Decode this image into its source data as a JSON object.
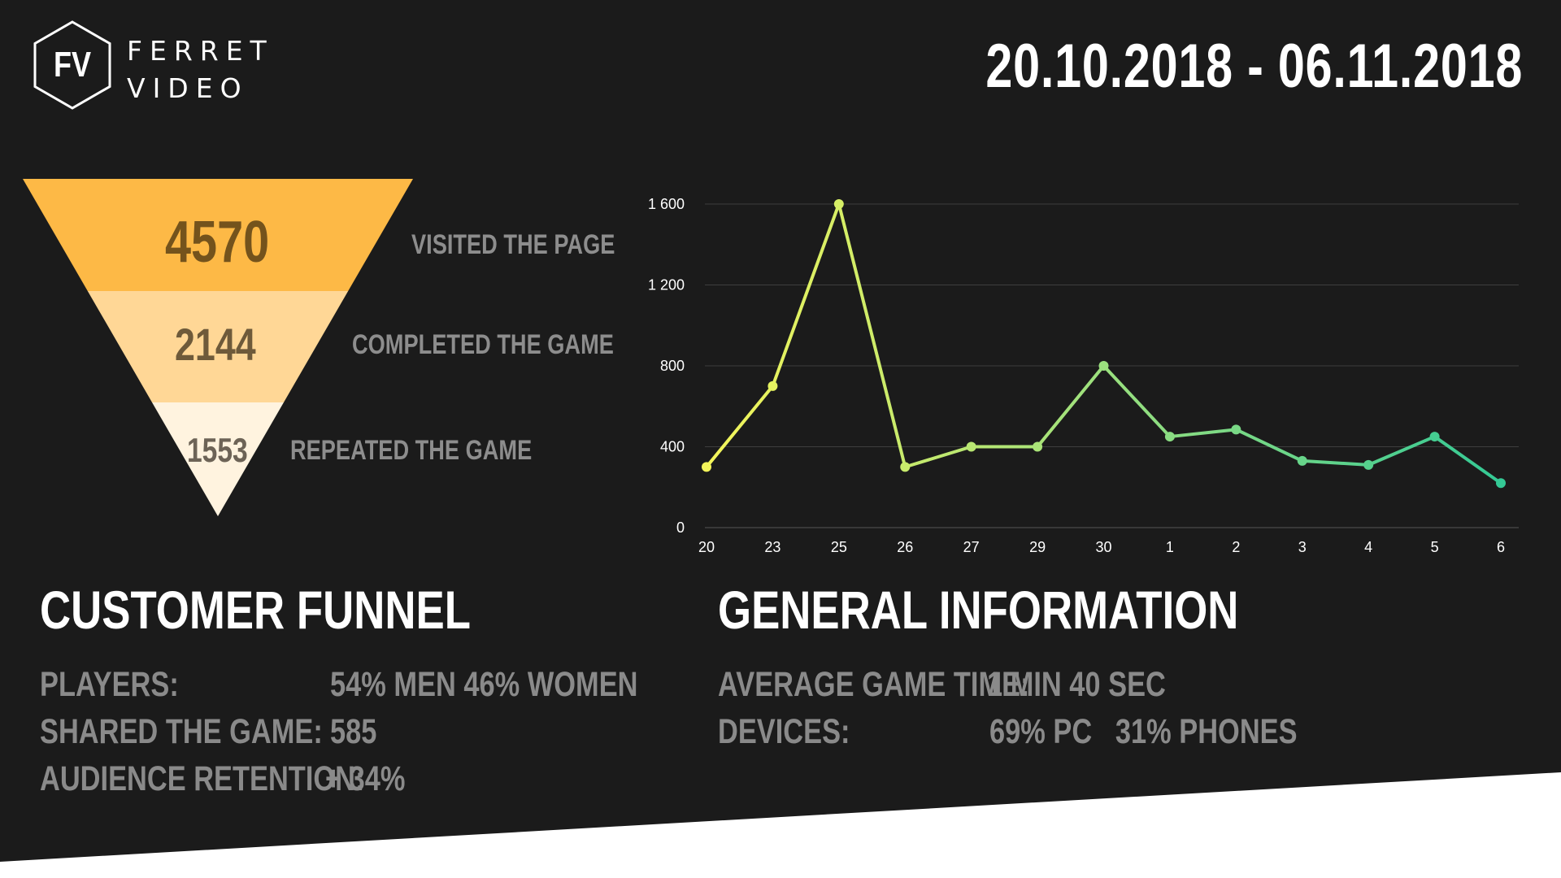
{
  "brand": {
    "logo_text": "FV",
    "name_line1": "FERRET",
    "name_line2": "VIDEO"
  },
  "header": {
    "date_range": "20.10.2018 - 06.11.2018"
  },
  "funnel": {
    "stages": [
      {
        "value": "4570",
        "label": "VISITED THE PAGE",
        "color": "#fdb946"
      },
      {
        "value": "2144",
        "label": "COMPLETED THE GAME",
        "color": "#ffd796"
      },
      {
        "value": "1553",
        "label": "REPEATED THE GAME",
        "color": "#fff3df"
      }
    ]
  },
  "customer_funnel": {
    "title": "CUSTOMER FUNNEL",
    "rows": [
      {
        "label": "PLAYERS:",
        "value": "54% MEN 46% WOMEN"
      },
      {
        "label": "SHARED THE GAME:",
        "value": "585"
      },
      {
        "label": "AUDIENCE RETENTION:",
        "value": "+ 34%"
      }
    ]
  },
  "general_info": {
    "title": "GENERAL INFORMATION",
    "rows": [
      {
        "label": "AVERAGE GAME TIME:",
        "value": "1 MIN 40 SEC"
      },
      {
        "label": "DEVICES:",
        "value": "69% PC   31% PHONES"
      }
    ]
  },
  "colors": {
    "background": "#1b1b1b",
    "gradient_start": "#f4f55a",
    "gradient_mid": "#9be07e",
    "gradient_end": "#34c995",
    "gridline": "#3e3e3e"
  },
  "chart_data": {
    "type": "line",
    "x": [
      "20",
      "23",
      "25",
      "26",
      "27",
      "29",
      "30",
      "1",
      "2",
      "3",
      "4",
      "5",
      "6"
    ],
    "series": [
      {
        "values": [
          300,
          700,
          1600,
          300,
          400,
          400,
          800,
          450,
          485,
          330,
          310,
          450,
          220
        ]
      }
    ],
    "yticks": [
      "0",
      "400",
      "800",
      "1 200",
      "1 600"
    ],
    "ytick_values": [
      0,
      400,
      800,
      1200,
      1600
    ],
    "ylim": [
      0,
      1600
    ],
    "grid": true,
    "title": "",
    "xlabel": "",
    "ylabel": ""
  }
}
